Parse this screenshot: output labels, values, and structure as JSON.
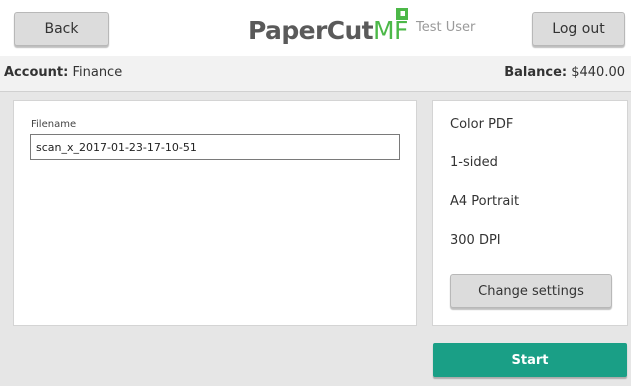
{
  "header": {
    "back_label": "Back",
    "logo_text_main": "PaperCut",
    "logo_text_suffix": "MF",
    "user_name": "Test User",
    "logout_label": "Log out"
  },
  "account": {
    "account_label": "Account:",
    "account_value": "Finance",
    "balance_label": "Balance:",
    "balance_value": "$440.00"
  },
  "scan": {
    "filename_label": "Filename",
    "filename_value": "scan_x_2017-01-23-17-10-51"
  },
  "settings": {
    "items": [
      "Color PDF",
      "1-sided",
      "A4 Portrait",
      "300 DPI"
    ],
    "change_label": "Change settings"
  },
  "actions": {
    "start_label": "Start"
  },
  "colors": {
    "accent": "#1a9f86",
    "logo_green": "#4cb848",
    "background": "#e6e6e6"
  }
}
